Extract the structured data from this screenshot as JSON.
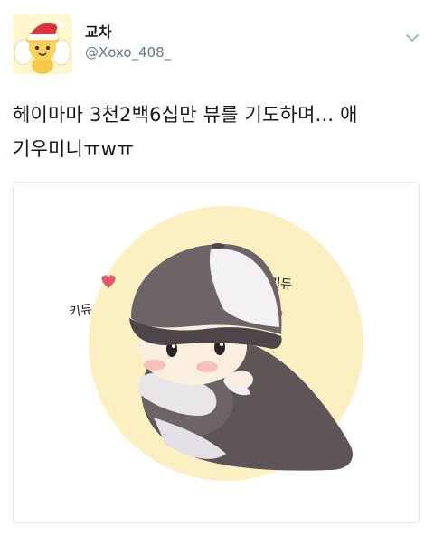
{
  "tweet": {
    "display_name": "교차",
    "handle": "@Xoxo_408_",
    "text": "헤이마마 3천2백6십만 뷰를 기도하며... 애\n기우미니ㅠwㅠ"
  },
  "icons": {
    "caret": "chevron-down-icon",
    "avatar": "cartoon-avatar-with-santa-hat"
  },
  "colors": {
    "text": "#14171a",
    "secondary": "#657786",
    "border": "#e1e8ed"
  },
  "image": {
    "left_label": "키듀",
    "right_label": "키듀"
  }
}
